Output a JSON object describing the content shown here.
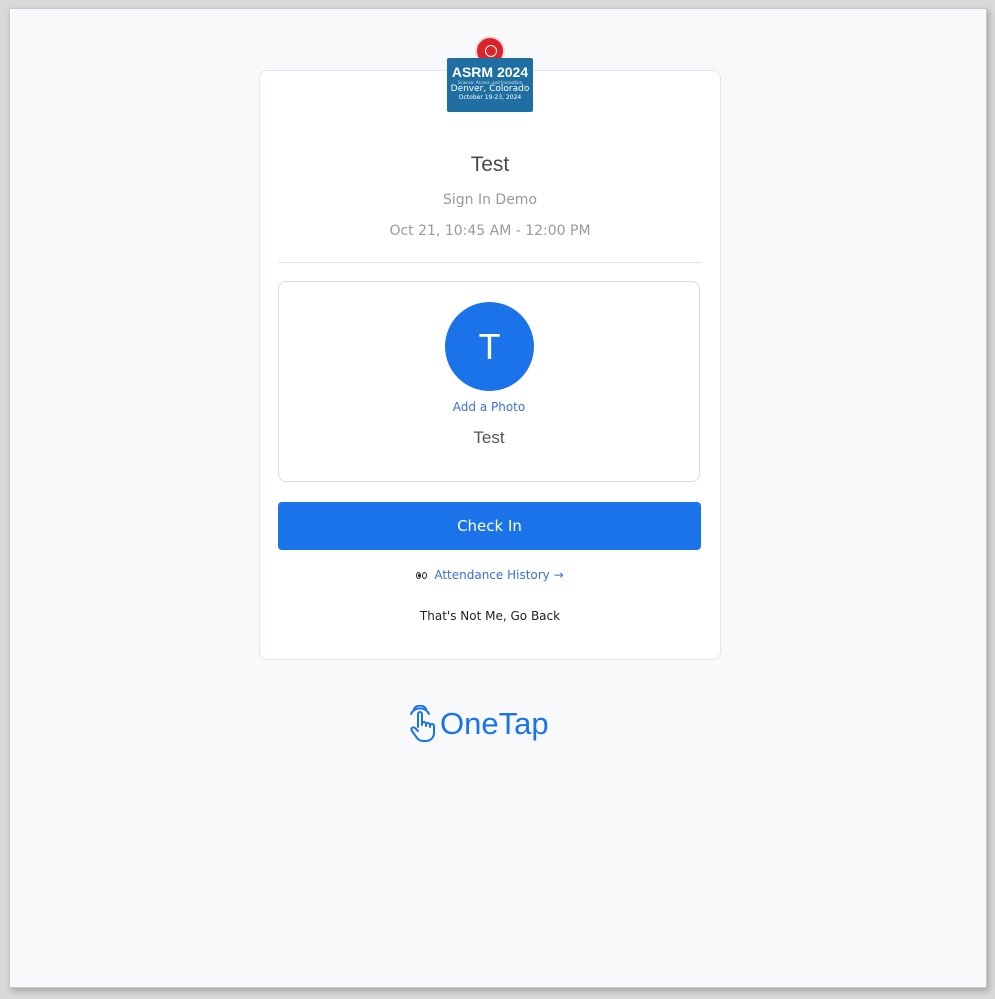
{
  "logo": {
    "line1": "ASRM 2024",
    "line2": "Science. Access. and Innovation",
    "line3": "Denver, Colorado",
    "line4": "October 19-23, 2024"
  },
  "event": {
    "title": "Test",
    "subtitle": "Sign In Demo",
    "time": "Oct 21, 10:45 AM - 12:00 PM"
  },
  "profile": {
    "initial": "T",
    "add_photo_label": "Add a Photo",
    "name": "Test"
  },
  "actions": {
    "check_in_label": "Check In",
    "attendance_history_label": "Attendance History →",
    "not_me_label": "That's Not Me, Go Back"
  },
  "brand": {
    "name": "OneTap"
  },
  "colors": {
    "primary": "#1a73e8",
    "link": "#3b6fd6",
    "background": "#f8f9fb"
  }
}
